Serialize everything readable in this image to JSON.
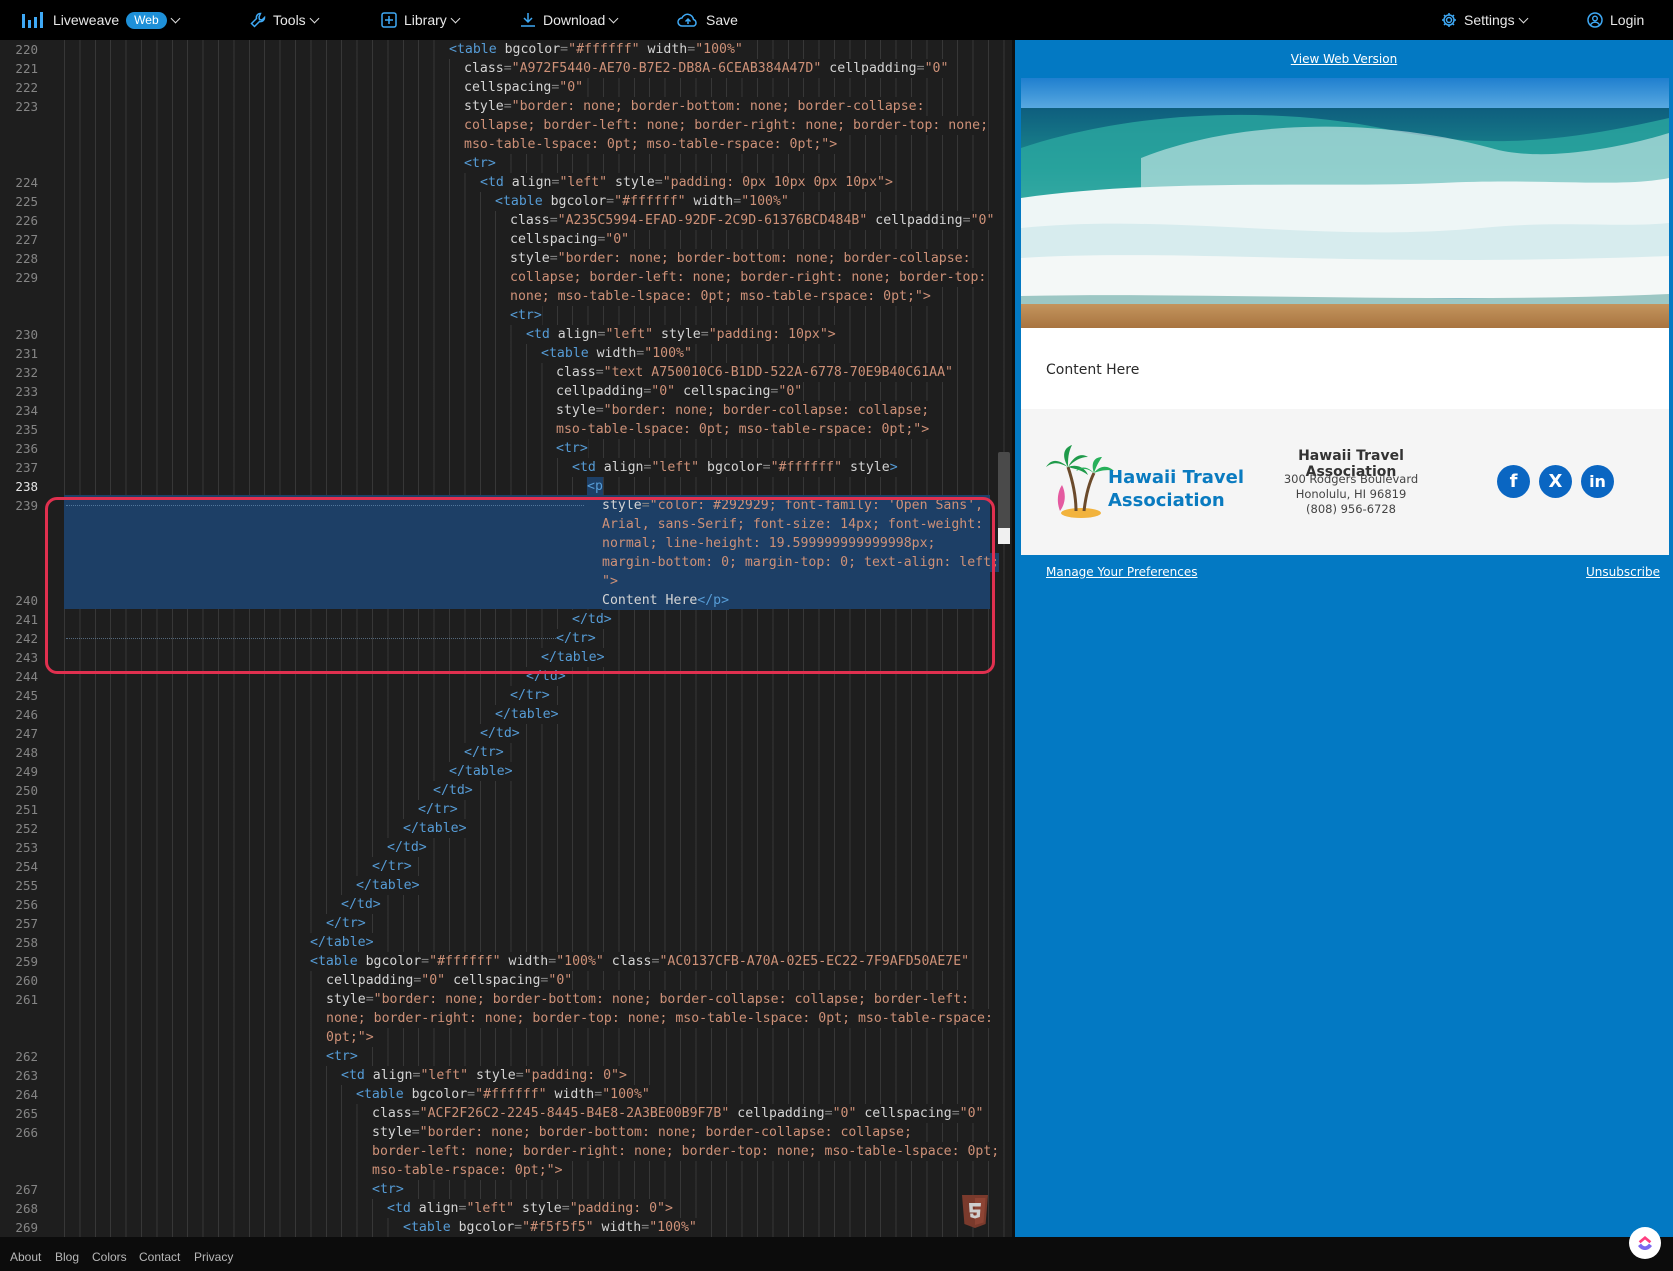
{
  "topbar": {
    "brand": "Liveweave",
    "badge": "Web",
    "tools": "Tools",
    "library": "Library",
    "download": "Download",
    "save": "Save",
    "settings": "Settings",
    "login": "Login",
    "icons": {
      "brand": "bar-chart-logo-icon",
      "tools": "wrench-icon",
      "library": "plus-square-icon",
      "download": "download-icon",
      "save": "cloud-upload-icon",
      "settings": "gear-icon",
      "login": "user-circle-icon"
    }
  },
  "editor": {
    "active_line": 238,
    "line_numbers": [
      "220",
      "221",
      "222",
      "223",
      "224",
      "225",
      "226",
      "227",
      "228",
      "229",
      "230",
      "231",
      "232",
      "233",
      "234",
      "235",
      "236",
      "237",
      "238",
      "239",
      "240",
      "241",
      "242",
      "243",
      "244",
      "245",
      "246",
      "247",
      "248",
      "249",
      "250",
      "251",
      "252",
      "253",
      "254",
      "255",
      "256",
      "257",
      "258",
      "259",
      "260",
      "261",
      "262",
      "263",
      "264",
      "265",
      "266",
      "267",
      "268",
      "269"
    ],
    "code": {
      "l0_t": "<table",
      "l0_a1": "bgcolor",
      "l0_v1": "\"#ffffff\"",
      "l0_a2": "width",
      "l0_v2": "\"100%\"",
      "l1_a1": "class",
      "l1_v1": "\"A972F5440-AE70-B7E2-DB8A-6CEAB384A47D\"",
      "l1_a2": "cellpadding",
      "l1_v2": "\"0\"",
      "l2_a1": "cellspacing",
      "l2_v1": "\"0\"",
      "l3_a1": "style",
      "l3_v1": "\"border: none; border-bottom: none; border-collapse:",
      "l4_v": "collapse; border-left: none; border-right: none; border-top: none;",
      "l5_v": "mso-table-lspace: 0pt; mso-table-rspace: 0pt;\">",
      "l6_t": "<tr>",
      "l7_t": "<td",
      "l7_a1": "align",
      "l7_v1": "\"left\"",
      "l7_a2": "style",
      "l7_v2": "\"padding: 0px 10px 0px 10px\">",
      "l8_t": "<table",
      "l8_a1": "bgcolor",
      "l8_v1": "\"#ffffff\"",
      "l8_a2": "width",
      "l8_v2": "\"100%\"",
      "l9_a1": "class",
      "l9_v1": "\"A235C5994-EFAD-92DF-2C9D-61376BCD484B\"",
      "l9_a2": "cellpadding",
      "l9_v2": "\"0\"",
      "l10_a1": "cellspacing",
      "l10_v1": "\"0\"",
      "l11_a1": "style",
      "l11_v1": "\"border: none; border-bottom: none; border-collapse:",
      "l12_v": "collapse; border-left: none; border-right: none; border-top:",
      "l13_v": "none; mso-table-lspace: 0pt; mso-table-rspace: 0pt;\">",
      "l14_t": "<tr>",
      "l15_t": "<td",
      "l15_a1": "align",
      "l15_v1": "\"left\"",
      "l15_a2": "style",
      "l15_v2": "\"padding: 10px\">",
      "l16_t": "<table",
      "l16_a1": "width",
      "l16_v1": "\"100%\"",
      "l17_a1": "class",
      "l17_v1": "\"text A750010C6-B1DD-522A-6778-70E9B40C61AA\"",
      "l18_a1": "cellpadding",
      "l18_v1": "\"0\"",
      "l18_a2": "cellspacing",
      "l18_v2": "\"0\"",
      "l19_a1": "style",
      "l19_v1": "\"border: none; border-collapse: collapse;",
      "l20_v": "mso-table-lspace: 0pt; mso-table-rspace: 0pt;\">",
      "l21_t": "<tr>",
      "l22_t": "<td",
      "l22_a1": "align",
      "l22_v1": "\"left\"",
      "l22_a2": "bgcolor",
      "l22_v2": "\"#ffffff\"",
      "l22_a3": "style",
      "l23_t": "<p",
      "l24_a1": "style",
      "l24_v1": "\"color: #292929; font-family: 'Open Sans',",
      "l25_v": "Arial, sans-Serif; font-size: 14px; font-weight:",
      "l26_v": "normal; line-height: 19.599999999999998px;",
      "l27_v": "margin-bottom: 0; margin-top: 0; text-align: left;",
      "l28_v": "\">",
      "l29_c": "Content Here",
      "l29_t": "</p>",
      "l30_t": "</td>",
      "l31_t": "</tr>",
      "l32_t": "</table>",
      "l33_t": "</td>",
      "l34_t": "</tr>",
      "l35_t": "</table>",
      "l36_t": "</td>",
      "l37_t": "</tr>",
      "l38_t": "</table>",
      "l39_t": "</td>",
      "l40_t": "</tr>",
      "l41_t": "</table>",
      "l42_t": "</td>",
      "l43_t": "</tr>",
      "l44_t": "</table>",
      "l45_t": "</td>",
      "l46_t": "</tr>",
      "l47_t": "</table>",
      "l48_t": "<table",
      "l48_a1": "bgcolor",
      "l48_v1": "\"#ffffff\"",
      "l48_a2": "width",
      "l48_v2": "\"100%\"",
      "l48_a3": "class",
      "l48_v3": "\"AC0137CFB-A70A-02E5-EC22-7F9AFD50AE7E\"",
      "l49_a1": "cellpadding",
      "l49_v1": "\"0\"",
      "l49_a2": "cellspacing",
      "l49_v2": "\"0\"",
      "l50_a1": "style",
      "l50_v1": "\"border: none; border-bottom: none; border-collapse: collapse; border-left:",
      "l51_v": "none; border-right: none; border-top: none; mso-table-lspace: 0pt; mso-table-rspace:",
      "l52_v": "0pt;\">",
      "l53_t": "<tr>",
      "l54_t": "<td",
      "l54_a1": "align",
      "l54_v1": "\"left\"",
      "l54_a2": "style",
      "l54_v2": "\"padding: 0\">",
      "l55_t": "<table",
      "l55_a1": "bgcolor",
      "l55_v1": "\"#ffffff\"",
      "l55_a2": "width",
      "l55_v2": "\"100%\"",
      "l56_a1": "class",
      "l56_v1": "\"ACF2F26C2-2245-8445-B4E8-2A3BE00B9F7B\"",
      "l56_a2": "cellpadding",
      "l56_v2": "\"0\"",
      "l56_a3": "cellspacing",
      "l56_v3": "\"0\"",
      "l57_a1": "style",
      "l57_v1": "\"border: none; border-bottom: none; border-collapse: collapse;",
      "l58_v": "border-left: none; border-right: none; border-top: none; mso-table-lspace: 0pt;",
      "l59_v": "mso-table-rspace: 0pt;\">",
      "l60_t": "<tr>",
      "l61_t": "<td",
      "l61_a1": "align",
      "l61_v1": "\"left\"",
      "l61_a2": "style",
      "l61_v2": "\"padding: 0\">",
      "l62_t": "<table",
      "l62_a1": "bgcolor",
      "l62_v1": "\"#f5f5f5\"",
      "l62_a2": "width",
      "l62_v2": "\"100%\""
    },
    "badge_icon": "html5-icon"
  },
  "preview": {
    "view_web_version": "View Web Version",
    "content_text": "Content Here",
    "org_name": "Hawaii Travel Association",
    "address_line1": "300 Rodgers Boulevard",
    "address_line2": "Honolulu, HI 96819",
    "phone": "(808) 956-6728",
    "logo_line1": "Hawaii Travel",
    "logo_line2": "Association",
    "manage_preferences": "Manage Your Preferences",
    "unsubscribe": "Unsubscribe",
    "social": {
      "facebook": "f",
      "x": "X",
      "linkedin": "in"
    },
    "colors": {
      "email_bg": "#0379c3",
      "brand_blue": "#0a7bc0",
      "social_blue": "#0a66c2"
    }
  },
  "footer": {
    "about": "About",
    "blog": "Blog",
    "colors": "Colors",
    "contact": "Contact",
    "privacy": "Privacy",
    "fab_icon": "clickup-logo-icon"
  }
}
